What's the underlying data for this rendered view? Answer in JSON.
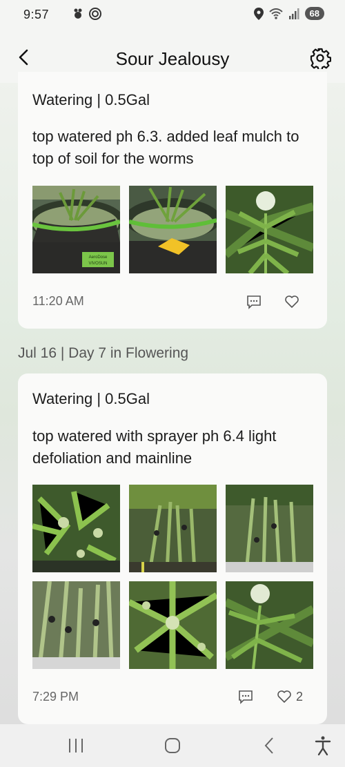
{
  "status": {
    "time": "9:57",
    "battery": "68"
  },
  "header": {
    "title": "Sour Jealousy"
  },
  "entries": [
    {
      "type": "Watering | 0.5Gal",
      "note": "top watered ph 6.3. added leaf mulch to top of soil for the worms",
      "time": "11:20 AM",
      "likes": ""
    },
    {
      "day_header": "Jul 16 | Day 7 in Flowering",
      "type": "Watering | 0.5Gal",
      "note": "top watered with sprayer ph 6.4 light defoliation and mainline",
      "time": "7:29 PM",
      "likes": "2"
    }
  ],
  "photo_labels": {
    "pot_brand": "AeroDose",
    "pot_brand_2": "VIVOSUN"
  },
  "icons": [
    "back-arrow-icon",
    "gear-icon",
    "comment-icon",
    "heart-icon",
    "recents-icon",
    "home-icon",
    "nav-back-icon",
    "accessibility-icon"
  ],
  "colors": {
    "accent_green": "#7bb33a",
    "card_bg": "#fafaf9"
  }
}
